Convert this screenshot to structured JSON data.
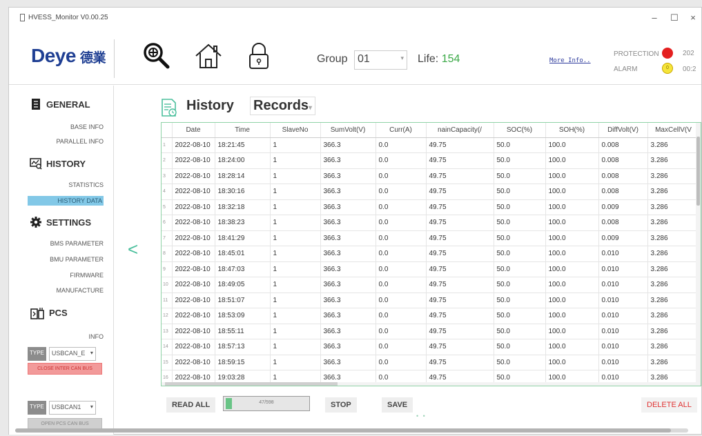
{
  "window": {
    "title": "HVESS_Monitor V0.00.25",
    "minimize": "–",
    "maximize": "☐",
    "close": "×"
  },
  "header": {
    "logo_text": "Deye",
    "logo_cn": "德業",
    "group_label": "Group",
    "group_value": "01",
    "life_label": "Life:",
    "life_value": "154",
    "more_info": "More Info..",
    "protection_label": "PROTECTION",
    "alarm_label": "ALARM",
    "alarm_badge": "0",
    "clip_top": "202",
    "clip_bottom": "00:2"
  },
  "sidebar": {
    "general": "GENERAL",
    "base_info": "BASE INFO",
    "parallel_info": "PARALLEL INFO",
    "history": "HISTORY",
    "statistics": "STATISTICS",
    "history_data": "HISTORY DATA",
    "settings": "SETTINGS",
    "bms_parameter": "BMS PARAMETER",
    "bmu_parameter": "BMU PARAMETER",
    "firmware": "FIRMWARE",
    "manufacture": "MANUFACTURE",
    "pcs": "PCS",
    "info": "INFO",
    "type_label": "TYPE",
    "type1_value": "USBCAN_E",
    "close_inter_can": "CLOSE INTER CAN BUS",
    "type2_value": "USBCAN1",
    "open_pcs_can": "OPEN PCS CAN BUS"
  },
  "page": {
    "back": "<",
    "title": "History",
    "subtitle": "Records"
  },
  "table": {
    "columns": [
      "",
      "Date",
      "Time",
      "SlaveNo",
      "SumVolt(V)",
      "Curr(A)",
      "nainCapacity(/",
      "SOC(%)",
      "SOH(%)",
      "DiffVolt(V)",
      "MaxCellV(V"
    ],
    "rows": [
      [
        "1",
        "2022-08-10",
        "18:21:45",
        "1",
        "366.3",
        "0.0",
        "49.75",
        "50.0",
        "100.0",
        "0.008",
        "3.286"
      ],
      [
        "2",
        "2022-08-10",
        "18:24:00",
        "1",
        "366.3",
        "0.0",
        "49.75",
        "50.0",
        "100.0",
        "0.008",
        "3.286"
      ],
      [
        "3",
        "2022-08-10",
        "18:28:14",
        "1",
        "366.3",
        "0.0",
        "49.75",
        "50.0",
        "100.0",
        "0.008",
        "3.286"
      ],
      [
        "4",
        "2022-08-10",
        "18:30:16",
        "1",
        "366.3",
        "0.0",
        "49.75",
        "50.0",
        "100.0",
        "0.008",
        "3.286"
      ],
      [
        "5",
        "2022-08-10",
        "18:32:18",
        "1",
        "366.3",
        "0.0",
        "49.75",
        "50.0",
        "100.0",
        "0.009",
        "3.286"
      ],
      [
        "6",
        "2022-08-10",
        "18:38:23",
        "1",
        "366.3",
        "0.0",
        "49.75",
        "50.0",
        "100.0",
        "0.008",
        "3.286"
      ],
      [
        "7",
        "2022-08-10",
        "18:41:29",
        "1",
        "366.3",
        "0.0",
        "49.75",
        "50.0",
        "100.0",
        "0.009",
        "3.286"
      ],
      [
        "8",
        "2022-08-10",
        "18:45:01",
        "1",
        "366.3",
        "0.0",
        "49.75",
        "50.0",
        "100.0",
        "0.010",
        "3.286"
      ],
      [
        "9",
        "2022-08-10",
        "18:47:03",
        "1",
        "366.3",
        "0.0",
        "49.75",
        "50.0",
        "100.0",
        "0.010",
        "3.286"
      ],
      [
        "10",
        "2022-08-10",
        "18:49:05",
        "1",
        "366.3",
        "0.0",
        "49.75",
        "50.0",
        "100.0",
        "0.010",
        "3.286"
      ],
      [
        "11",
        "2022-08-10",
        "18:51:07",
        "1",
        "366.3",
        "0.0",
        "49.75",
        "50.0",
        "100.0",
        "0.010",
        "3.286"
      ],
      [
        "12",
        "2022-08-10",
        "18:53:09",
        "1",
        "366.3",
        "0.0",
        "49.75",
        "50.0",
        "100.0",
        "0.010",
        "3.286"
      ],
      [
        "13",
        "2022-08-10",
        "18:55:11",
        "1",
        "366.3",
        "0.0",
        "49.75",
        "50.0",
        "100.0",
        "0.010",
        "3.286"
      ],
      [
        "14",
        "2022-08-10",
        "18:57:13",
        "1",
        "366.3",
        "0.0",
        "49.75",
        "50.0",
        "100.0",
        "0.010",
        "3.286"
      ],
      [
        "15",
        "2022-08-10",
        "18:59:15",
        "1",
        "366.3",
        "0.0",
        "49.75",
        "50.0",
        "100.0",
        "0.010",
        "3.286"
      ],
      [
        "16",
        "2022-08-10",
        "19:03:28",
        "1",
        "366.3",
        "0.0",
        "49.75",
        "50.0",
        "100.0",
        "0.010",
        "3.286"
      ]
    ]
  },
  "controls": {
    "read_all": "READ ALL",
    "progress_text": "47/598",
    "progress_fraction": 0.079,
    "stop": "STOP",
    "save": "SAVE",
    "delete_all": "DELETE ALL",
    "pager": "• •"
  },
  "colors": {
    "accent": "#4abf9c",
    "brand": "#1f3f93",
    "life": "#39a845",
    "protection": "#e41f1f",
    "alarm": "#f5e53a",
    "active_nav": "#82c8e7",
    "danger": "#e03030"
  }
}
